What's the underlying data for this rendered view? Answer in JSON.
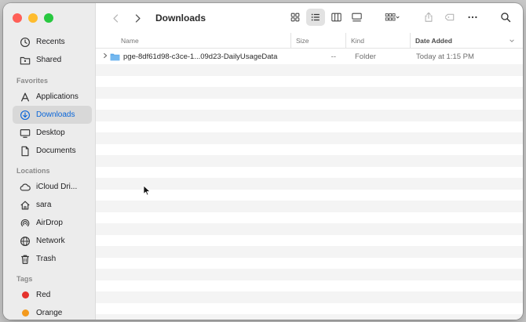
{
  "window": {
    "title": "Downloads"
  },
  "sidebar": {
    "top_items": [
      {
        "label": "Recents",
        "icon": "clock-icon"
      },
      {
        "label": "Shared",
        "icon": "shared-folder-icon"
      }
    ],
    "favorites_label": "Favorites",
    "favorites": [
      {
        "label": "Applications",
        "icon": "applications-icon"
      },
      {
        "label": "Downloads",
        "icon": "downloads-icon",
        "active": true
      },
      {
        "label": "Desktop",
        "icon": "desktop-icon"
      },
      {
        "label": "Documents",
        "icon": "document-icon"
      }
    ],
    "locations_label": "Locations",
    "locations": [
      {
        "label": "iCloud Dri...",
        "icon": "cloud-icon"
      },
      {
        "label": "sara",
        "icon": "home-icon"
      },
      {
        "label": "AirDrop",
        "icon": "airdrop-icon"
      },
      {
        "label": "Network",
        "icon": "globe-icon"
      },
      {
        "label": "Trash",
        "icon": "trash-icon"
      }
    ],
    "tags_label": "Tags",
    "tags": [
      {
        "label": "Red",
        "color": "#e5322d"
      },
      {
        "label": "Orange",
        "color": "#f39a1e"
      }
    ]
  },
  "columns": {
    "name": "Name",
    "size": "Size",
    "kind": "Kind",
    "date": "Date Added"
  },
  "files": [
    {
      "name": "pge-8df61d98-c3ce-1...09d23-DailyUsageData",
      "size": "--",
      "kind": "Folder",
      "date": "Today at 1:15 PM"
    }
  ],
  "colors": {
    "accent": "#0a66d8",
    "folder": "#5aa7e8"
  }
}
